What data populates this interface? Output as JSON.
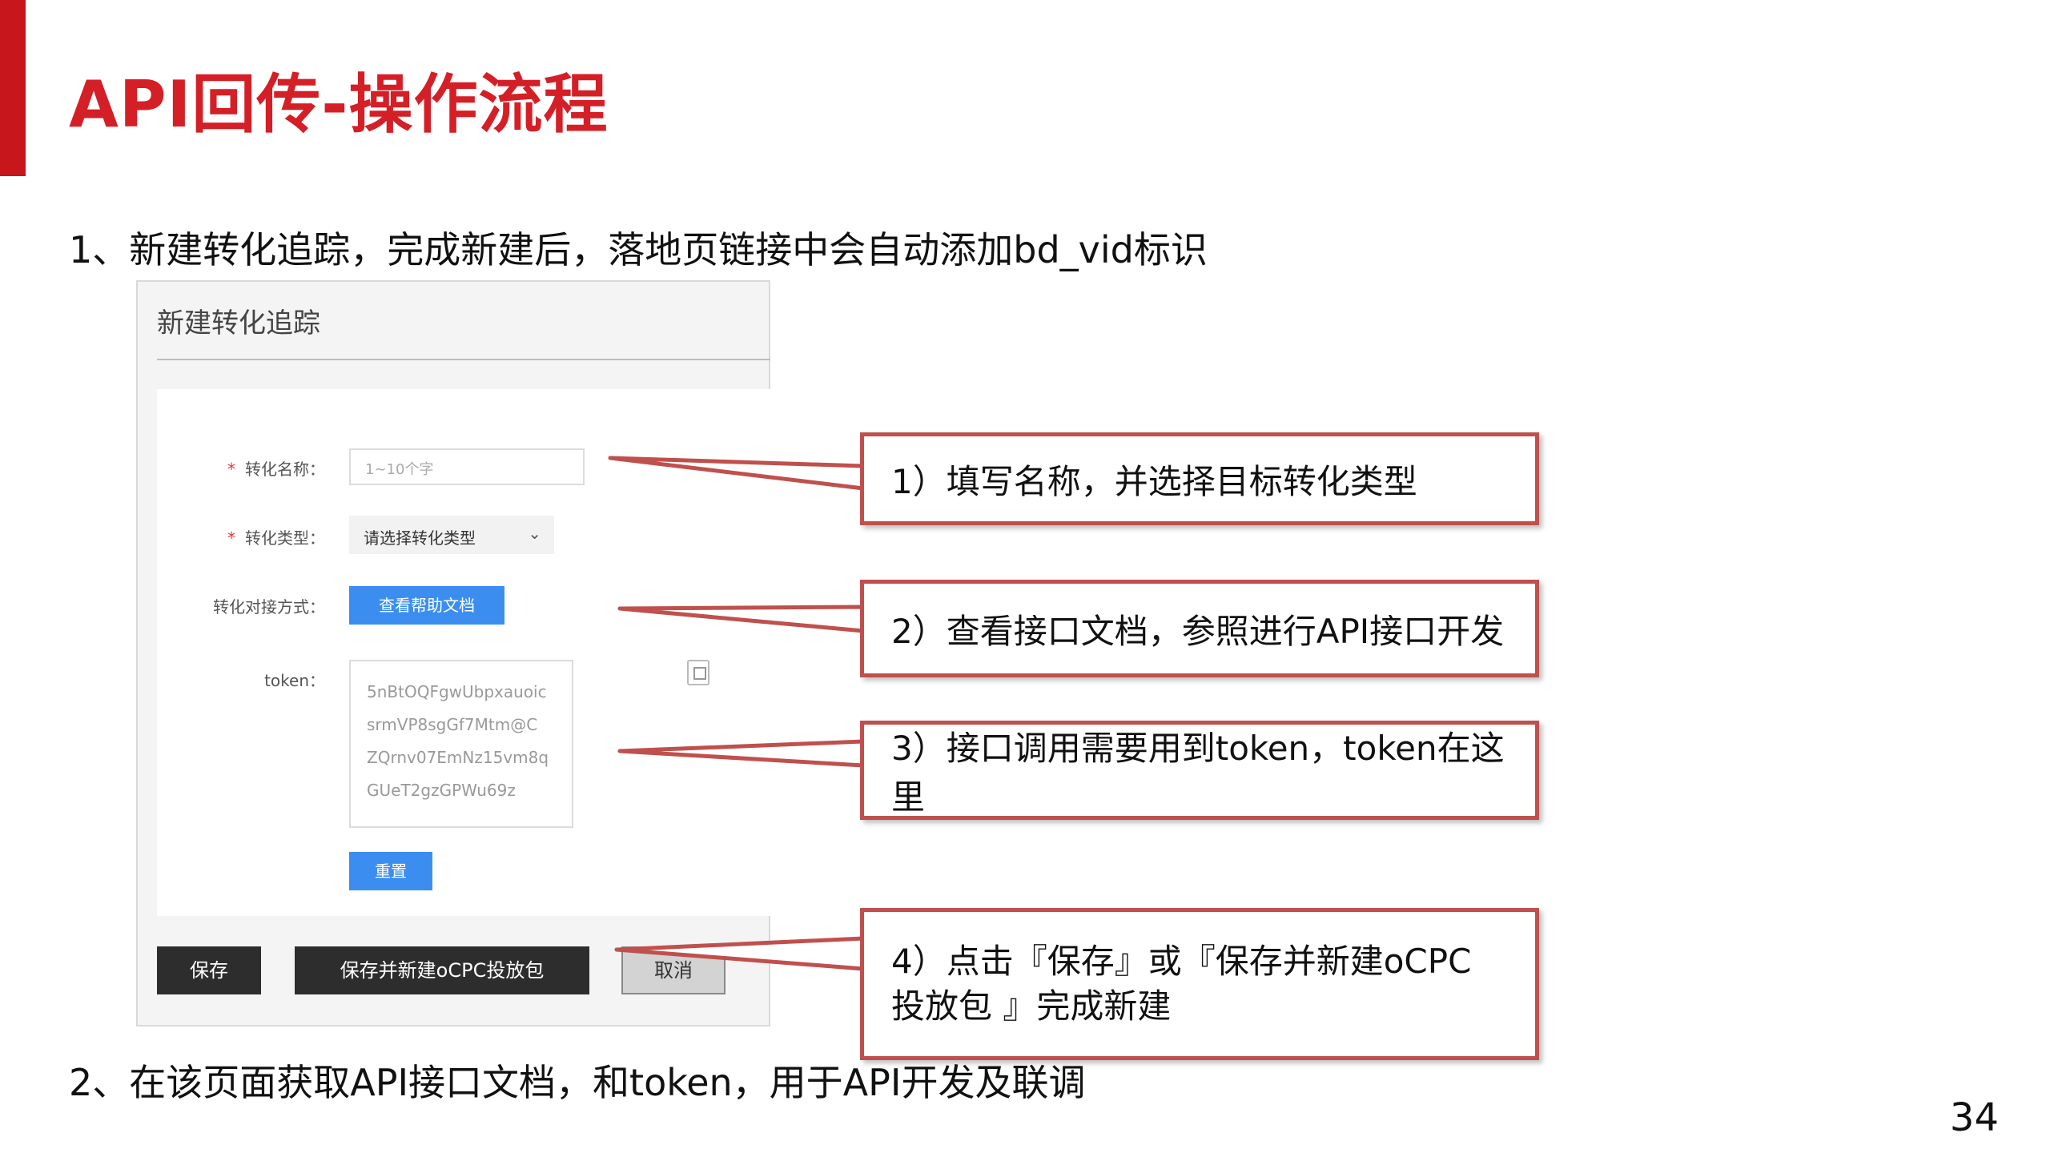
{
  "title": "API回传-操作流程",
  "step1": "1、新建转化追踪，完成新建后，落地页链接中会自动添加bd_vid标识",
  "step2": "2、在该页面获取API接口文档，和token，用于API开发及联调",
  "page_number": "34",
  "panel": {
    "title": "新建转化追踪",
    "name_label": "转化名称：",
    "name_placeholder": "1~10个字",
    "type_label": "转化类型：",
    "type_value": "请选择转化类型",
    "method_label": "转化对接方式：",
    "help_button": "查看帮助文档",
    "token_label": "token：",
    "token_lines": [
      "5nBtOQFgwUbpxauoic",
      "srmVP8sgGf7Mtm@C",
      "ZQrnv07EmNz15vm8q",
      "GUeT2gzGPWu69z"
    ],
    "reset_button": "重置",
    "save_button": "保存",
    "save_ocpc_button": "保存并新建oCPC投放包",
    "cancel_button": "取消"
  },
  "callouts": [
    "1）填写名称，并选择目标转化类型",
    "2）查看接口文档，参照进行API接口开发",
    "3）接口调用需要用到token，token在这里",
    "4）点击『保存』或『保存并新建oCPC\n投放包 』完成新建"
  ],
  "colors": {
    "title_red": "#d41f26",
    "callout_border": "#c0504d",
    "primary_blue": "#3b8ef0"
  }
}
